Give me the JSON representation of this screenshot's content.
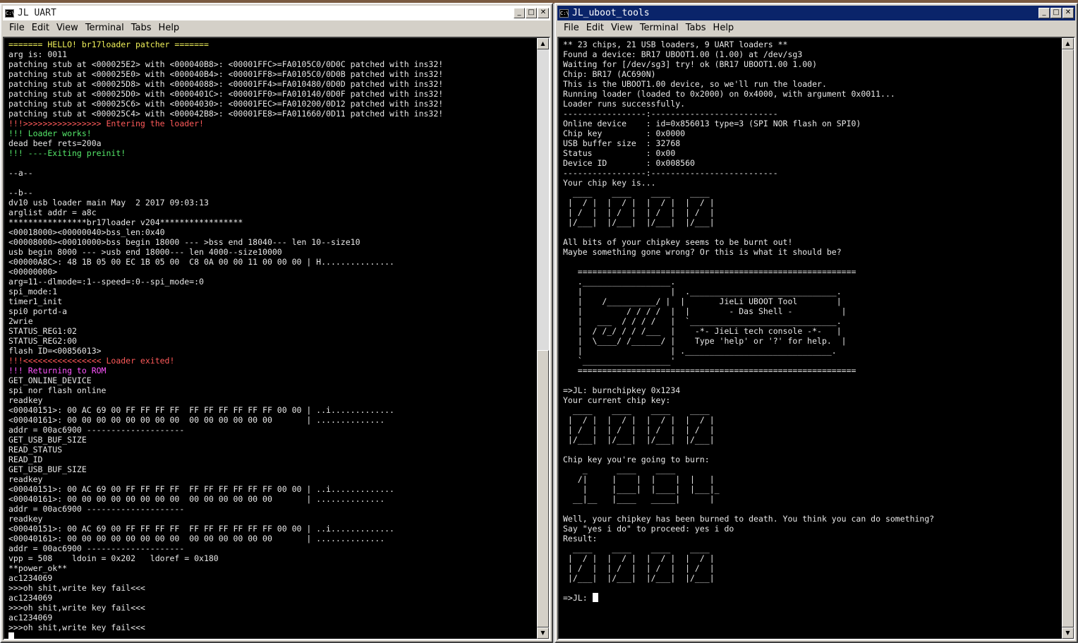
{
  "left": {
    "title": "JL UART",
    "menu": [
      "File",
      "Edit",
      "View",
      "Terminal",
      "Tabs",
      "Help"
    ],
    "lines": [
      {
        "t": "======= HELLO! br17loader patcher =======",
        "c": "yellow"
      },
      {
        "t": "arg is: 0011",
        "c": "white"
      },
      {
        "t": "patching stub at <000025E2> with <000040B8>: <00001FFC>=FA0105C0/0D0C patched with ins32!",
        "c": "white"
      },
      {
        "t": "patching stub at <000025E0> with <000040B4>: <00001FF8>=FA0105C0/0D0B patched with ins32!",
        "c": "white"
      },
      {
        "t": "patching stub at <000025D8> with <00004088>: <00001FF4>=FA010480/0D0D patched with ins32!",
        "c": "white"
      },
      {
        "t": "patching stub at <000025D0> with <0000401C>: <00001FF0>=FA010140/0D0F patched with ins32!",
        "c": "white"
      },
      {
        "t": "patching stub at <000025C6> with <00004030>: <00001FEC>=FA010200/0D12 patched with ins32!",
        "c": "white"
      },
      {
        "t": "patching stub at <000025C4> with <000042B8>: <00001FE8>=FA011660/0D11 patched with ins32!",
        "c": "white"
      },
      {
        "t": "!!!>>>>>>>>>>>>>>>> Entering the loader!",
        "c": "red"
      },
      {
        "t": "!!! Loader works!",
        "c": "green"
      },
      {
        "t": "dead beef rets=200a",
        "c": "white"
      },
      {
        "t": "!!! ----Exiting preinit!",
        "c": "green"
      },
      {
        "t": "",
        "c": "white"
      },
      {
        "t": "--a--",
        "c": "white"
      },
      {
        "t": "",
        "c": "white"
      },
      {
        "t": "--b--",
        "c": "white"
      },
      {
        "t": "dv10 usb loader main May  2 2017 09:03:13",
        "c": "white"
      },
      {
        "t": "arglist addr = a8c",
        "c": "white"
      },
      {
        "t": "****************br17loader v204*****************",
        "c": "white"
      },
      {
        "t": "<00018000><00000040>bss_len:0x40",
        "c": "white"
      },
      {
        "t": "<00008000><00010000>bss begin 18000 --- >bss end 18040--- len 10--size10",
        "c": "white"
      },
      {
        "t": "usb begin 8000 --- >usb end 18000--- len 4000--size10000",
        "c": "white"
      },
      {
        "t": "<00000A8C>: 48 1B 05 00 EC 1B 05 00  C8 0A 00 00 11 00 00 00 | H...............",
        "c": "white"
      },
      {
        "t": "<00000000>",
        "c": "white"
      },
      {
        "t": "arg=11--dlmode=:1--speed=:0--spi_mode=:0",
        "c": "white"
      },
      {
        "t": "spi_mode:1",
        "c": "white"
      },
      {
        "t": "timer1_init",
        "c": "white"
      },
      {
        "t": "spi0 portd-a",
        "c": "white"
      },
      {
        "t": "2wrie",
        "c": "white"
      },
      {
        "t": "STATUS_REG1:02",
        "c": "white"
      },
      {
        "t": "STATUS_REG2:00",
        "c": "white"
      },
      {
        "t": "flash ID=<00856013>",
        "c": "white"
      },
      {
        "t": "!!!<<<<<<<<<<<<<<<< Loader exited!",
        "c": "red"
      },
      {
        "t": "!!! Returning to ROM",
        "c": "magenta"
      },
      {
        "t": "GET_ONLINE_DEVICE",
        "c": "white"
      },
      {
        "t": "spi nor flash online",
        "c": "white"
      },
      {
        "t": "readkey",
        "c": "white"
      },
      {
        "t": "<00040151>: 00 AC 69 00 FF FF FF FF  FF FF FF FF FF FF 00 00 | ..i.............",
        "c": "white"
      },
      {
        "t": "<00040161>: 00 00 00 00 00 00 00 00  00 00 00 00 00 00       | ..............",
        "c": "white"
      },
      {
        "t": "addr = 00ac6900 --------------------",
        "c": "white"
      },
      {
        "t": "GET_USB_BUF_SIZE",
        "c": "white"
      },
      {
        "t": "READ_STATUS",
        "c": "white"
      },
      {
        "t": "READ_ID",
        "c": "white"
      },
      {
        "t": "GET_USB_BUF_SIZE",
        "c": "white"
      },
      {
        "t": "readkey",
        "c": "white"
      },
      {
        "t": "<00040151>: 00 AC 69 00 FF FF FF FF  FF FF FF FF FF FF 00 00 | ..i.............",
        "c": "white"
      },
      {
        "t": "<00040161>: 00 00 00 00 00 00 00 00  00 00 00 00 00 00       | ..............",
        "c": "white"
      },
      {
        "t": "addr = 00ac6900 --------------------",
        "c": "white"
      },
      {
        "t": "readkey",
        "c": "white"
      },
      {
        "t": "<00040151>: 00 AC 69 00 FF FF FF FF  FF FF FF FF FF FF 00 00 | ..i.............",
        "c": "white"
      },
      {
        "t": "<00040161>: 00 00 00 00 00 00 00 00  00 00 00 00 00 00       | ..............",
        "c": "white"
      },
      {
        "t": "addr = 00ac6900 --------------------",
        "c": "white"
      },
      {
        "t": "vpp = 508    ldoin = 0x202   ldoref = 0x180",
        "c": "white"
      },
      {
        "t": "**power_ok**",
        "c": "white"
      },
      {
        "t": "ac1234069",
        "c": "white"
      },
      {
        "t": ">>>oh shit,write key fail<<<",
        "c": "white"
      },
      {
        "t": "ac1234069",
        "c": "white"
      },
      {
        "t": ">>>oh shit,write key fail<<<",
        "c": "white"
      },
      {
        "t": "ac1234069",
        "c": "white"
      },
      {
        "t": ">>>oh shit,write key fail<<<",
        "c": "white"
      }
    ]
  },
  "right": {
    "title": "JL_uboot_tools",
    "menu": [
      "File",
      "Edit",
      "View",
      "Terminal",
      "Tabs",
      "Help"
    ],
    "prompt": "=>JL: ",
    "lines": [
      "** 23 chips, 21 USB loaders, 9 UART loaders **",
      "Found a device: BR17 UBOOT1.00 (1.00) at /dev/sg3",
      "Waiting for [/dev/sg3] try! ok (BR17 UBOOT1.00 1.00)",
      "Chip: BR17 (AC690N)",
      "This is the UBOOT1.00 device, so we'll run the loader.",
      "Running loader (loaded to 0x2000) on 0x4000, with argument 0x0011...",
      "Loader runs successfully.",
      "-----------------:--------------------------",
      "Online device    : id=0x856013 type=3 (SPI NOR flash on SPI0)",
      "Chip key         : 0x0000",
      "USB buffer size  : 32768",
      "Status           : 0x00",
      "Device ID        : 0x008560",
      "-----------------:--------------------------",
      "Your chip key is...",
      "  ____    ____    ____    ____",
      " |  / |  |  / |  |  / |  |  / |",
      " | /  |  | /  |  | /  |  | /  |",
      " |/___|  |/___|  |/___|  |/___|",
      "",
      "All bits of your chipkey seems to be burnt out!",
      "Maybe something gone wrong? Or this is what it should be?",
      "",
      "   =========================================================",
      "   .__________________.",
      "   |                  |  .______________________________.",
      "   |    /__________/ |  |       JieLi UBOOT Tool        |",
      "   |         / / / /  |  |        - Das Shell -          |",
      "   |   ___  / / / /   |  `______________________________.",
      "   |  / /_/ / / /___  |    -*- JieLi tech console -*-   |",
      "   |  \\____/ /______/ |    Type 'help' or '?' for help.  |",
      "   |                  | .______________________________.",
      "   `__________________'",
      "   =========================================================",
      "",
      "=>JL: burnchipkey 0x1234",
      "Your current chip key:",
      "  ____    ____    ____    ____",
      " |  / |  |  / |  |  / |  |  / |",
      " | /  |  | /  |  | /  |  | /  |",
      " |/___|  |/___|  |/___|  |/___|",
      "",
      "Chip key you're going to burn:",
      "    _      ____    ____",
      "   /|     |    |  |    |  |   |",
      "    |     |____|  |____|  |___|_",
      "  __|__   |____   _____|      |",
      "",
      "Well, your chipkey has been burned to death. You think you can do something?",
      "Say \"yes i do\" to proceed: yes i do",
      "Result:",
      "  ____    ____    ____    ____",
      " |  / |  |  / |  |  / |  |  / |",
      " | /  |  | /  |  | /  |  | /  |",
      " |/___|  |/___|  |/___|  |/___|",
      ""
    ]
  }
}
